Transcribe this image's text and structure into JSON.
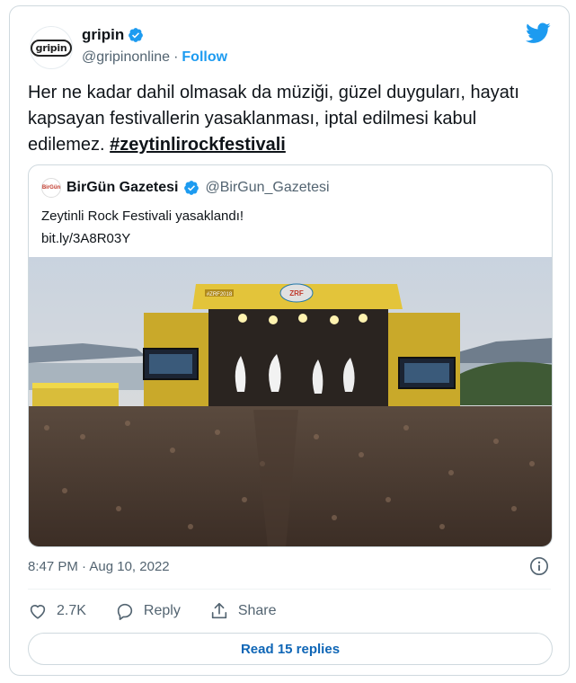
{
  "author": {
    "avatar_text": "gripin",
    "name": "gripin",
    "handle": "@gripinonline",
    "separator": "·",
    "follow_label": "Follow"
  },
  "tweet": {
    "text": "Her ne kadar dahil olmasak da müziği, güzel duyguları, hayatı kapsayan festivallerin yasaklanması, iptal edilmesi kabul edilemez.",
    "hashtag": "#zeytinlirockfestivali"
  },
  "quoted": {
    "avatar_text": "BirGün",
    "name": "BirGün Gazetesi",
    "handle": "@BirGun_Gazetesi",
    "text": "Zeytinli Rock Festivali yasaklandı!",
    "link": "bit.ly/3A8R03Y",
    "image": {
      "stage_banner": "#ZRF2018",
      "stage_logo": "ZRF"
    }
  },
  "meta": {
    "time": "8:47 PM",
    "separator": "·",
    "date": "Aug 10, 2022"
  },
  "actions": {
    "likes": "2.7K",
    "reply_label": "Reply",
    "share_label": "Share"
  },
  "read_replies_label": "Read 15 replies",
  "colors": {
    "accent": "#1d9bf0",
    "verified": "#1d9bf0",
    "text": "#0f1419",
    "secondary": "#536471",
    "border": "#cfd9de"
  },
  "icons": {
    "bird": "twitter-bird-icon",
    "verified": "verified-badge-icon",
    "info": "info-icon",
    "like": "heart-icon",
    "reply": "reply-icon",
    "share": "share-icon"
  }
}
